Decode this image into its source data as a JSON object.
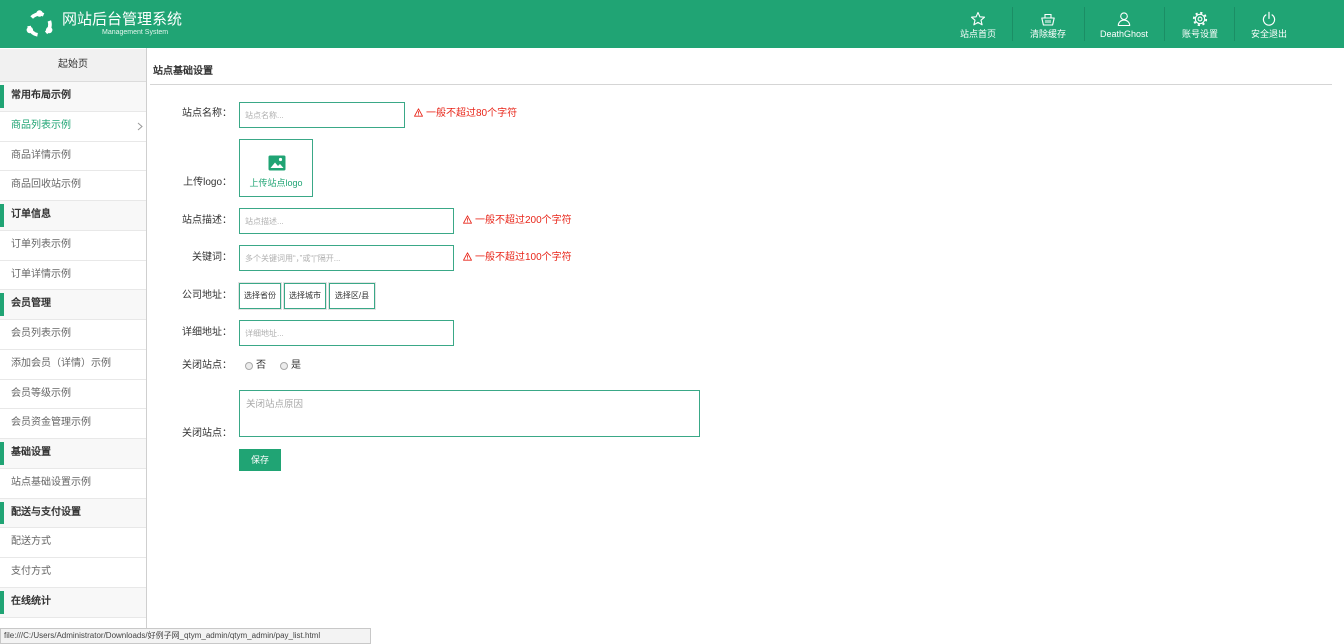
{
  "header": {
    "title": "网站后台管理系统",
    "subtitle": "Management System",
    "nav": [
      {
        "label": "站点首页",
        "icon": "star-icon"
      },
      {
        "label": "清除缓存",
        "icon": "basket-icon"
      },
      {
        "label": "DeathGhost",
        "icon": "user-icon"
      },
      {
        "label": "账号设置",
        "icon": "gear-icon"
      },
      {
        "label": "安全退出",
        "icon": "power-icon"
      }
    ]
  },
  "sidebar": {
    "home": "起始页",
    "groups": [
      {
        "title": "常用布局示例",
        "items": [
          {
            "label": "商品列表示例",
            "active": true
          },
          {
            "label": "商品详情示例"
          },
          {
            "label": "商品回收站示例"
          }
        ]
      },
      {
        "title": "订单信息",
        "items": [
          {
            "label": "订单列表示例"
          },
          {
            "label": "订单详情示例"
          }
        ]
      },
      {
        "title": "会员管理",
        "items": [
          {
            "label": "会员列表示例"
          },
          {
            "label": "添加会员（详情）示例"
          },
          {
            "label": "会员等级示例"
          },
          {
            "label": "会员资金管理示例"
          }
        ]
      },
      {
        "title": "基础设置",
        "items": [
          {
            "label": "站点基础设置示例"
          }
        ]
      },
      {
        "title": "配送与支付设置",
        "items": [
          {
            "label": "配送方式"
          },
          {
            "label": "支付方式"
          }
        ]
      },
      {
        "title": "在线统计",
        "items": []
      }
    ]
  },
  "main": {
    "title": "站点基础设置",
    "form": {
      "site_name": {
        "label": "站点名称：",
        "placeholder": "站点名称...",
        "hint": "一般不超过80个字符"
      },
      "logo": {
        "label": "上传logo：",
        "upload_text": "上传站点logo"
      },
      "description": {
        "label": "站点描述：",
        "placeholder": "站点描述...",
        "hint": "一般不超过200个字符"
      },
      "keywords": {
        "label": "关键词：",
        "placeholder": "多个关键词用“，”或“|”隔开...",
        "hint": "一般不超过100个字符"
      },
      "address": {
        "label": "公司地址：",
        "province": "选择省份",
        "city": "选择城市",
        "district": "选择区/县"
      },
      "detail_address": {
        "label": "详细地址：",
        "placeholder": "详细地址..."
      },
      "close_site": {
        "label": "关闭站点：",
        "options": [
          "否",
          "是"
        ]
      },
      "close_reason": {
        "label": "关闭站点：",
        "placeholder": "关闭站点原因"
      },
      "save_label": "保存"
    }
  },
  "status_bar": {
    "url": "file:///C:/Users/Administrator/Downloads/好例子网_qtym_admin/qtym_admin/pay_list.html"
  },
  "colors": {
    "accent": "#20a474",
    "warning": "#e8261a",
    "input_border": "#3aa887"
  }
}
